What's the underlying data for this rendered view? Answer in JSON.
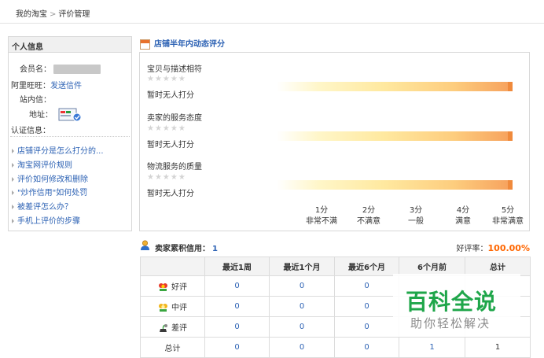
{
  "breadcrumb": {
    "home": "我的淘宝",
    "separator": ">",
    "current": "评价管理"
  },
  "personal_info": {
    "title": "个人信息",
    "member_label": "会员名：",
    "wangwang_label": "阿里旺旺：",
    "send_message": "发送信件",
    "inbox_label": "站内信：",
    "address_label": "地址：",
    "verify_label": "认证信息："
  },
  "help_links": [
    "店铺评分是怎么打分的...",
    "淘宝网评价规则",
    "评价如何修改和删除",
    "\"炒作信用\"如何处罚",
    "被差评怎么办？",
    "手机上评价的步骤"
  ],
  "rating": {
    "title": "店铺半年内动态评分",
    "categories": [
      {
        "name": "宝贝与描述相符",
        "stars": "★★★★★",
        "status": "暂时无人打分"
      },
      {
        "name": "卖家的服务态度",
        "stars": "★★★★★",
        "status": "暂时无人打分"
      },
      {
        "name": "物流服务的质量",
        "stars": "★★★★★",
        "status": "暂时无人打分"
      }
    ],
    "scale": [
      {
        "score": "1分",
        "label": "非常不满"
      },
      {
        "score": "2分",
        "label": "不满意"
      },
      {
        "score": "3分",
        "label": "一般"
      },
      {
        "score": "4分",
        "label": "满意"
      },
      {
        "score": "5分",
        "label": "非常满意"
      }
    ]
  },
  "credit": {
    "label": "卖家累积信用：",
    "value": "1",
    "rate_label": "好评率：",
    "rate_value": "100.00%",
    "headers": [
      "",
      "最近1周",
      "最近1个月",
      "最近6个月",
      "6个月前",
      "总计"
    ],
    "rows": [
      {
        "label": "好评",
        "icon": "good-review-flower-icon",
        "values": [
          "0",
          "0",
          "0",
          "",
          ""
        ]
      },
      {
        "label": "中评",
        "icon": "neutral-review-flower-icon",
        "values": [
          "0",
          "0",
          "0",
          "",
          ""
        ]
      },
      {
        "label": "差评",
        "icon": "bad-review-wilted-flower-icon",
        "values": [
          "0",
          "0",
          "0",
          "",
          ""
        ]
      },
      {
        "label": "总计",
        "icon": "",
        "values": [
          "0",
          "0",
          "0",
          "1",
          "1"
        ]
      }
    ]
  },
  "watermark": {
    "title": "百科全说",
    "subtitle": "助你轻松解决"
  },
  "colors": {
    "link": "#2d62b4",
    "accent_orange": "#f60",
    "watermark_green": "#1fa64a"
  }
}
